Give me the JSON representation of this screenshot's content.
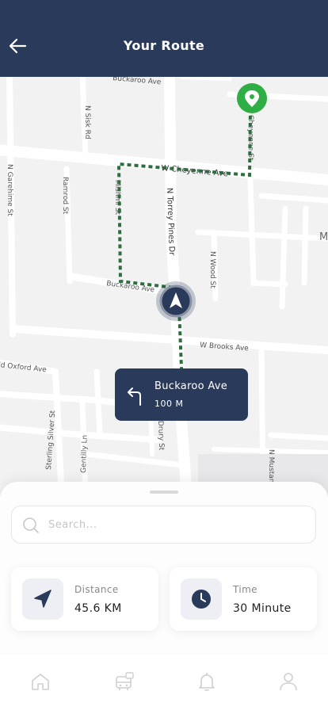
{
  "header": {
    "title": "Your Route",
    "back_icon": "arrow-left-icon",
    "background": "#2a3a5a"
  },
  "map": {
    "streets": {
      "cheyenne": "W Cheyenne Ave",
      "torrey": "N Torrey Pines Dr",
      "brooks": "W Brooks Ave",
      "buckaroo": "Buckaroo Ave",
      "oxford": "ld Oxford Ave",
      "garehime": "N Garehime St",
      "ramrod": "Ramrod St",
      "sisk": "N Sisk Rd",
      "sterling": "Sterling Silver St",
      "gentilly": "Gentilly Ln",
      "drury": "Drury St",
      "mustang": "N Mustan",
      "mishmi": "Mishmi St",
      "top": "Cheyenne St",
      "nwood": "N Wood St",
      "top_ave": "Buckaroo Ave"
    },
    "edge_letter": "M",
    "route_color": "#2e6e3e",
    "destination_color": "#2fae45"
  },
  "instruction": {
    "street": "Buckaroo Ave",
    "distance": "100 M",
    "icon": "turn-left-icon"
  },
  "search": {
    "placeholder": "Search..."
  },
  "stats": {
    "distance": {
      "label": "Distance",
      "value": "45.6 KM",
      "icon": "navigation-arrow-icon"
    },
    "time": {
      "label": "Time",
      "value": "30 Minute",
      "icon": "clock-icon"
    }
  },
  "nav": {
    "items": [
      "home-icon",
      "bus-icon",
      "bell-icon",
      "user-icon"
    ]
  }
}
